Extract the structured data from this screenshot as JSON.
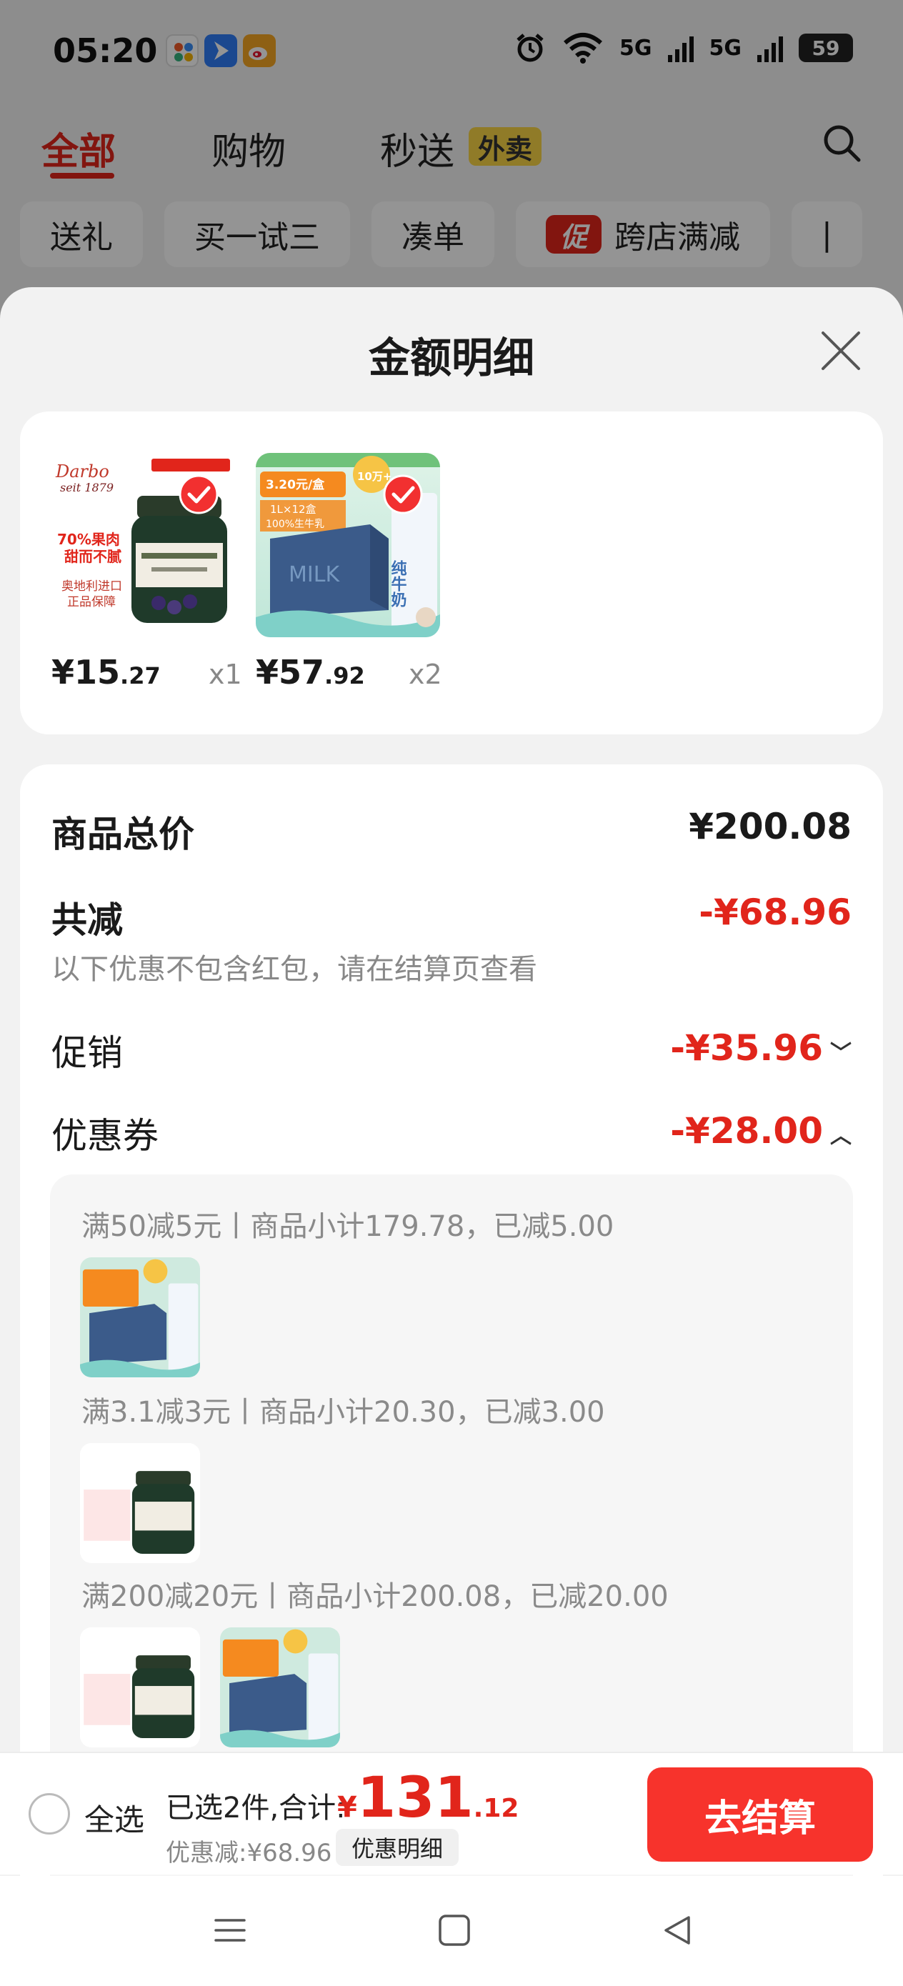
{
  "status_bar": {
    "time": "05:20",
    "network_1": "5G",
    "network_2": "5G",
    "battery": "59",
    "icons": [
      "app-icon",
      "feishu-icon",
      "weibo-icon",
      "alarm-icon",
      "wifi-icon",
      "signal-icon",
      "signal-icon",
      "battery-icon"
    ]
  },
  "top_nav": {
    "tabs": [
      {
        "label": "全部",
        "active": true
      },
      {
        "label": "购物",
        "active": false
      },
      {
        "label": "秒送",
        "active": false
      }
    ],
    "waimai_tag": "外卖",
    "search_icon": "search-icon"
  },
  "filter_chips": [
    {
      "label": "送礼"
    },
    {
      "label": "买一试三"
    },
    {
      "label": "凑单"
    },
    {
      "label": "跨店满减",
      "badge": "促"
    },
    {
      "label": "|"
    }
  ],
  "sheet": {
    "title": "金额明细",
    "close_icon": "close-icon"
  },
  "products": [
    {
      "image_brand": "Darbo",
      "image_since": "seit 1879",
      "image_tag_1": "70%果肉",
      "image_tag_2": "甜而不腻",
      "image_tag_3": "奥地利进口",
      "image_tag_4": "正品保障",
      "price_int": "¥15",
      "price_dec": ".27",
      "qty": "x1",
      "selected": true
    },
    {
      "image_tag_1": "3.20元/盒",
      "image_tag_2": "1L×12盒",
      "image_tag_3": "100%生牛乳",
      "image_badge": "10万+",
      "image_product": "纯牛奶",
      "price_int": "¥57",
      "price_dec": ".92",
      "qty": "x2",
      "selected": true
    }
  ],
  "summary": {
    "total_label": "商品总价",
    "total_value": "¥200.08",
    "reduce_label": "共减",
    "reduce_value": "-¥68.96",
    "reduce_note": "以下优惠不包含红包，请在结算页查看",
    "promo_label": "促销",
    "promo_value": "-¥35.96",
    "coupon_label": "优惠券",
    "coupon_value": "-¥28.00"
  },
  "coupons": [
    {
      "text": "满50减5元丨商品小计179.78，已减5.00"
    },
    {
      "text": "满3.1减3元丨商品小计20.30，已减3.00"
    },
    {
      "text": "满200减20元丨商品小计200.08，已减20.00"
    }
  ],
  "bottom_bar": {
    "select_all": "全选",
    "selected_text": "已选2件,合计:",
    "currency": "¥",
    "total_int": "131",
    "total_dec": ".12",
    "discount_text": "优惠减:¥68.96",
    "detail_button": "优惠明细",
    "checkout_button": "去结算"
  },
  "nav_bar": {
    "icons": [
      "menu-icon",
      "home-icon",
      "back-icon"
    ]
  },
  "colors": {
    "accent_red": "#e1251b",
    "checkout_red": "#f7332c",
    "waimai_yellow": "#f8d545"
  }
}
